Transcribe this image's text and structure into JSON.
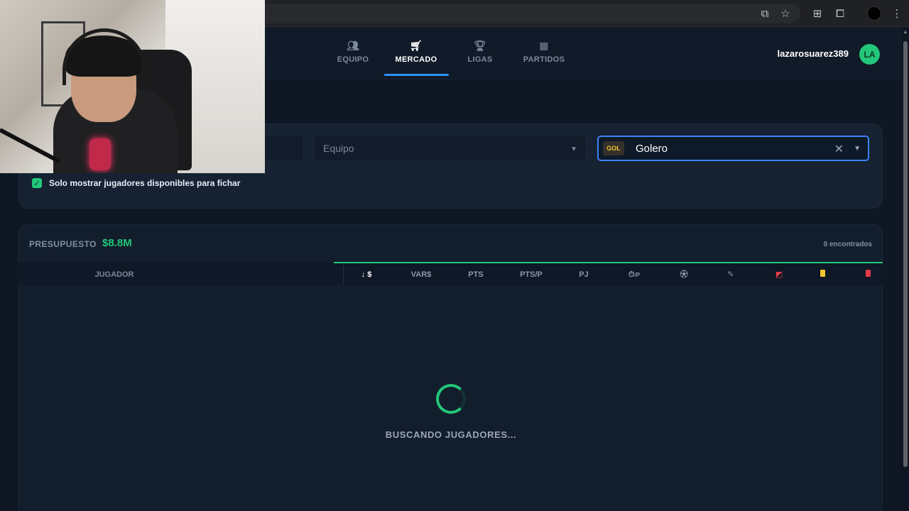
{
  "nav": {
    "tabs": [
      {
        "label": "EQUIPO",
        "icon": "team-icon"
      },
      {
        "label": "MERCADO",
        "icon": "cart-icon",
        "active": true
      },
      {
        "label": "LIGAS",
        "icon": "trophy-icon"
      },
      {
        "label": "PARTIDOS",
        "icon": "calendar-icon"
      }
    ],
    "username": "lazarosuarez389",
    "avatar_initials": "LA"
  },
  "filters": {
    "team_placeholder": "Equipo",
    "position_badge": "GOL",
    "position_value": "Golero",
    "only_available_label": "Solo mostrar jugadores disponibles para fichar",
    "only_available_checked": true
  },
  "results": {
    "budget_label": "PRESUPUESTO",
    "budget_value": "$8.8M",
    "found_count": "0 encontrados",
    "columns": {
      "player": "JUGADOR",
      "price": "$",
      "var_price": "VAR$",
      "points": "PTS",
      "points_per_match": "PTS/P",
      "matches_played": "PJ",
      "minutes_per_match": "/P"
    },
    "loading_text": "BUSCANDO JUGADORES..."
  },
  "colors": {
    "accent_green": "#22c778",
    "accent_blue": "#2f8ff5",
    "background": "#0f1724",
    "yellow_card": "#f4c430",
    "red_card": "#e53946"
  }
}
